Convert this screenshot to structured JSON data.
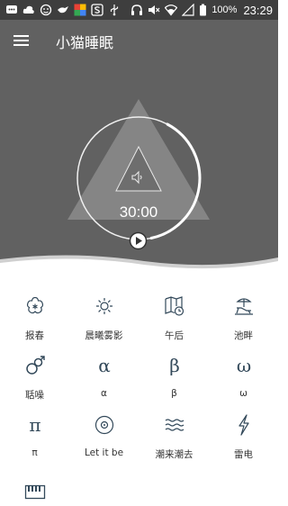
{
  "status_bar": {
    "battery_percent": "100%",
    "time": "23:29",
    "left_icons": [
      "chat-icon",
      "cloud-icon",
      "face-icon",
      "bird-icon",
      "app-color-icon",
      "s-icon",
      "usb-icon"
    ],
    "right_icons": [
      "headphones-icon",
      "volume-mute-icon",
      "wifi-icon",
      "signal-icon",
      "battery-icon"
    ]
  },
  "header": {
    "title": "小猫睡眠"
  },
  "player": {
    "timer": "30:00"
  },
  "sounds": [
    {
      "label": "报春",
      "icon": "flower-icon"
    },
    {
      "label": "晨曦雾影",
      "icon": "sun-icon"
    },
    {
      "label": "午后",
      "icon": "map-clock-icon"
    },
    {
      "label": "池畔",
      "icon": "beach-chair-icon"
    },
    {
      "label": "聒噪",
      "icon": "gender-circles-icon"
    },
    {
      "label": "α",
      "icon": "alpha-icon"
    },
    {
      "label": "β",
      "icon": "beta-icon"
    },
    {
      "label": "ω",
      "icon": "omega-icon"
    },
    {
      "label": "π",
      "icon": "pi-icon"
    },
    {
      "label": "Let it be",
      "icon": "vinyl-icon"
    },
    {
      "label": "潮来潮去",
      "icon": "waves-icon"
    },
    {
      "label": "雷电",
      "icon": "lightning-icon"
    },
    {
      "label": "",
      "icon": "piano-icon"
    }
  ],
  "colors": {
    "status_bar": "#3e3e3e",
    "hero": "#616161",
    "icon_stroke": "#33495a",
    "label": "#333333"
  }
}
